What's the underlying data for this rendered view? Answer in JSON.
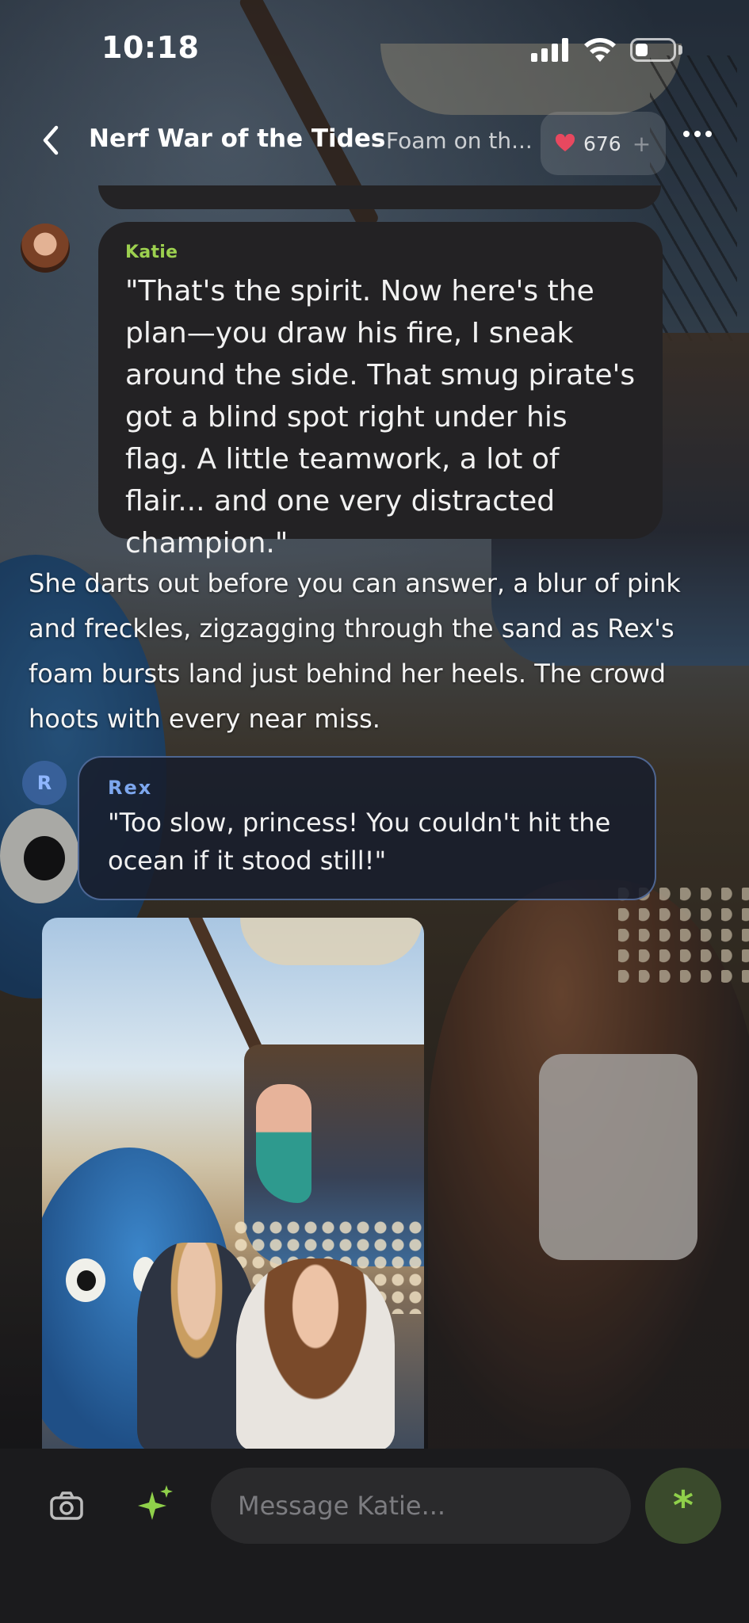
{
  "status_bar": {
    "time": "10:18"
  },
  "header": {
    "title": "Nerf War of the Tides",
    "separator": "·",
    "subtitle": "Foam on th...",
    "like_count": "676",
    "like_plus": "+"
  },
  "messages": [
    {
      "speaker": "Katie",
      "text": "\"That's the spirit. Now here's the plan—you draw his fire, I sneak around the side. That smug pirate's got a blind spot right under his flag. A little teamwork, a lot of flair... and one very distracted champion.\""
    },
    {
      "type": "narration",
      "text": "She darts out before you can answer, a blur of pink and freckles, zigzagging through the sand as Rex's foam bursts land just behind her heels. The crowd hoots with every near miss."
    },
    {
      "speaker": "Rex",
      "avatar_letter": "R",
      "text": "\"Too slow, princess! You couldn't hit the ocean if it stood still!\""
    }
  ],
  "composer": {
    "placeholder": "Message Katie...",
    "send_glyph": "*"
  },
  "colors": {
    "katie_name": "#9cd04f",
    "rex_name": "#7da7ee",
    "send_icon": "#8fd04a",
    "like_heart": "#e8485f"
  },
  "icons": [
    "back-arrow-icon",
    "heart-icon",
    "more-dots-icon",
    "camera-icon",
    "sparkle-icon",
    "asterisk-send-icon"
  ]
}
